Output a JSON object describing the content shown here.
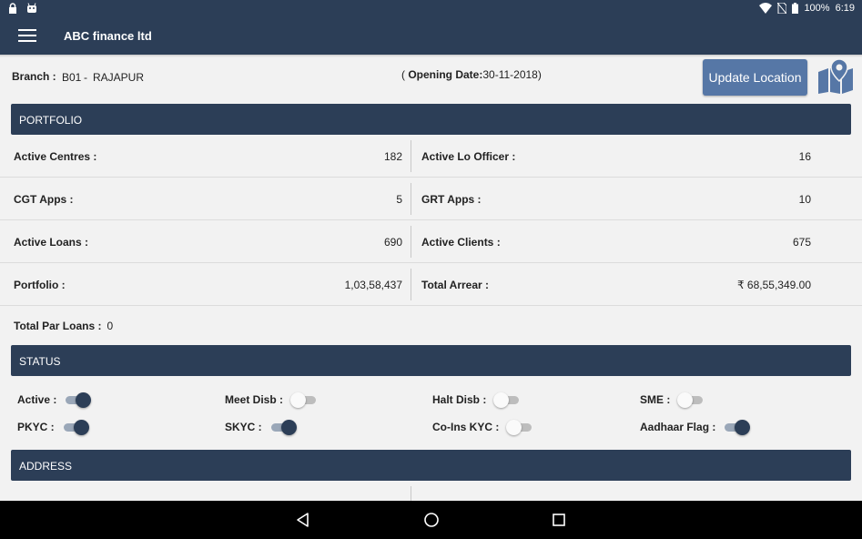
{
  "statusbar": {
    "left_icons": [
      "lock-icon",
      "android-icon"
    ],
    "right_icons": [
      "wifi-icon",
      "no-sim-icon",
      "battery-icon"
    ],
    "battery": "100%",
    "time": "6:19"
  },
  "appbar": {
    "title": "ABC finance ltd",
    "menu_icon": "hamburger-menu-icon"
  },
  "branch": {
    "label": "Branch :",
    "code": "B01",
    "separator": "-",
    "name": "RAJAPUR",
    "opening_label": "Opening Date:",
    "opening_date": "30-11-2018",
    "update_button": "Update Location",
    "map_icon": "map-location-icon"
  },
  "portfolio": {
    "header": "PORTFOLIO",
    "rows": [
      {
        "left_label": "Active Centres :",
        "left_value": "182",
        "right_label": "Active Lo Officer :",
        "right_value": "16"
      },
      {
        "left_label": "CGT Apps :",
        "left_value": "5",
        "right_label": "GRT Apps :",
        "right_value": "10"
      },
      {
        "left_label": "Active Loans :",
        "left_value": "690",
        "right_label": "Active Clients :",
        "right_value": "675"
      },
      {
        "left_label": "Portfolio :",
        "left_value": "1,03,58,437",
        "right_label": "Total Arrear :",
        "right_value": "₹ 68,55,349.00"
      }
    ],
    "par_label": "Total Par Loans :",
    "par_value": "0"
  },
  "status": {
    "header": "STATUS",
    "toggles": [
      {
        "label": "Active :",
        "on": true
      },
      {
        "label": "Meet Disb :",
        "on": false
      },
      {
        "label": "Halt Disb :",
        "on": false
      },
      {
        "label": "SME :",
        "on": false
      },
      {
        "label": "PKYC :",
        "on": true
      },
      {
        "label": "SKYC :",
        "on": true
      },
      {
        "label": "Co-Ins KYC :",
        "on": false
      },
      {
        "label": "Aadhaar Flag :",
        "on": true
      }
    ]
  },
  "address": {
    "header": "ADDRESS"
  },
  "navbar": {
    "buttons": [
      "back-icon",
      "home-icon",
      "recents-icon"
    ]
  },
  "colors": {
    "primary": "#2c3e57",
    "button": "#5677a6",
    "background": "#f2f2f2"
  }
}
